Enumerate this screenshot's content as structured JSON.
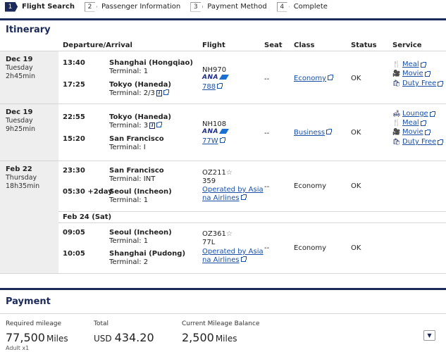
{
  "steps": [
    {
      "num": "1",
      "label": "Flight Search"
    },
    {
      "num": "2",
      "label": "Passenger Information"
    },
    {
      "num": "3",
      "label": "Payment Method"
    },
    {
      "num": "4",
      "label": "Complete"
    }
  ],
  "itinerary": {
    "title": "Itinerary",
    "headers": {
      "dep_arr": "Departure/Arrival",
      "flight": "Flight",
      "seat": "Seat",
      "class": "Class",
      "status": "Status",
      "service": "Service"
    },
    "segments": [
      {
        "date": "Dec 19",
        "weekday": "Tuesday",
        "duration": "2h45min",
        "dep_time": "13:40",
        "dep_city": "Shanghai (Hongqiao)",
        "dep_terminal": "Terminal: 1",
        "arr_time": "17:25",
        "arr_city": "Tokyo (Haneda)",
        "arr_terminal": "Terminal: 2/3",
        "flight_no": "NH970",
        "airline_logo": "ANA",
        "aircraft": "788",
        "seat": "--",
        "class": "Economy",
        "status": "OK",
        "services": [
          "Meal",
          "Movie",
          "Duty Free"
        ]
      },
      {
        "date": "Dec 19",
        "weekday": "Tuesday",
        "duration": "9h25min",
        "dep_time": "22:55",
        "dep_city": "Tokyo (Haneda)",
        "dep_terminal": "Terminal: 3",
        "arr_time": "15:20",
        "arr_city": "San Francisco",
        "arr_terminal": "Terminal: I",
        "flight_no": "NH108",
        "airline_logo": "ANA",
        "aircraft": "77W",
        "seat": "--",
        "class": "Business",
        "status": "OK",
        "services": [
          "Lounge",
          "Meal",
          "Movie",
          "Duty Free"
        ]
      },
      {
        "date": "Feb 22",
        "weekday": "Thursday",
        "duration": "18h35min",
        "dep_time": "23:30",
        "dep_city": "San Francisco",
        "dep_terminal": "Terminal: INT",
        "arr_time": "05:30 +2day",
        "arr_city": "Seoul (Incheon)",
        "arr_terminal": "Terminal: 1",
        "flight_no": "OZ211",
        "aircraft": "359",
        "operated_line1": "Operated by Asia",
        "operated_line2": "na Airlines",
        "seat": "--",
        "class": "Economy",
        "status": "OK",
        "sub_date": "Feb 24 (Sat)"
      },
      {
        "dep_time": "09:05",
        "dep_city": "Seoul (Incheon)",
        "dep_terminal": "Terminal: 1",
        "arr_time": "10:05",
        "arr_city": "Shanghai (Pudong)",
        "arr_terminal": "Terminal: 2",
        "flight_no": "OZ361",
        "aircraft": "77L",
        "operated_line1": "Operated by Asia",
        "operated_line2": "na Airlines",
        "seat": "--",
        "class": "Economy",
        "status": "OK"
      }
    ]
  },
  "payment": {
    "title": "Payment",
    "required_mileage_label": "Required mileage",
    "required_mileage_value": "77,500",
    "required_mileage_unit": "Miles",
    "passengers": "Adult x1",
    "total_label": "Total",
    "total_currency": "USD",
    "total_value": "434.20",
    "balance_label": "Current Mileage Balance",
    "balance_value": "2,500",
    "balance_unit": "Miles"
  },
  "icons": {
    "info": "i",
    "star": "☆",
    "dropdown": "▼"
  },
  "colors": {
    "brand": "#1b2a5a",
    "link": "#1a4fa8"
  }
}
